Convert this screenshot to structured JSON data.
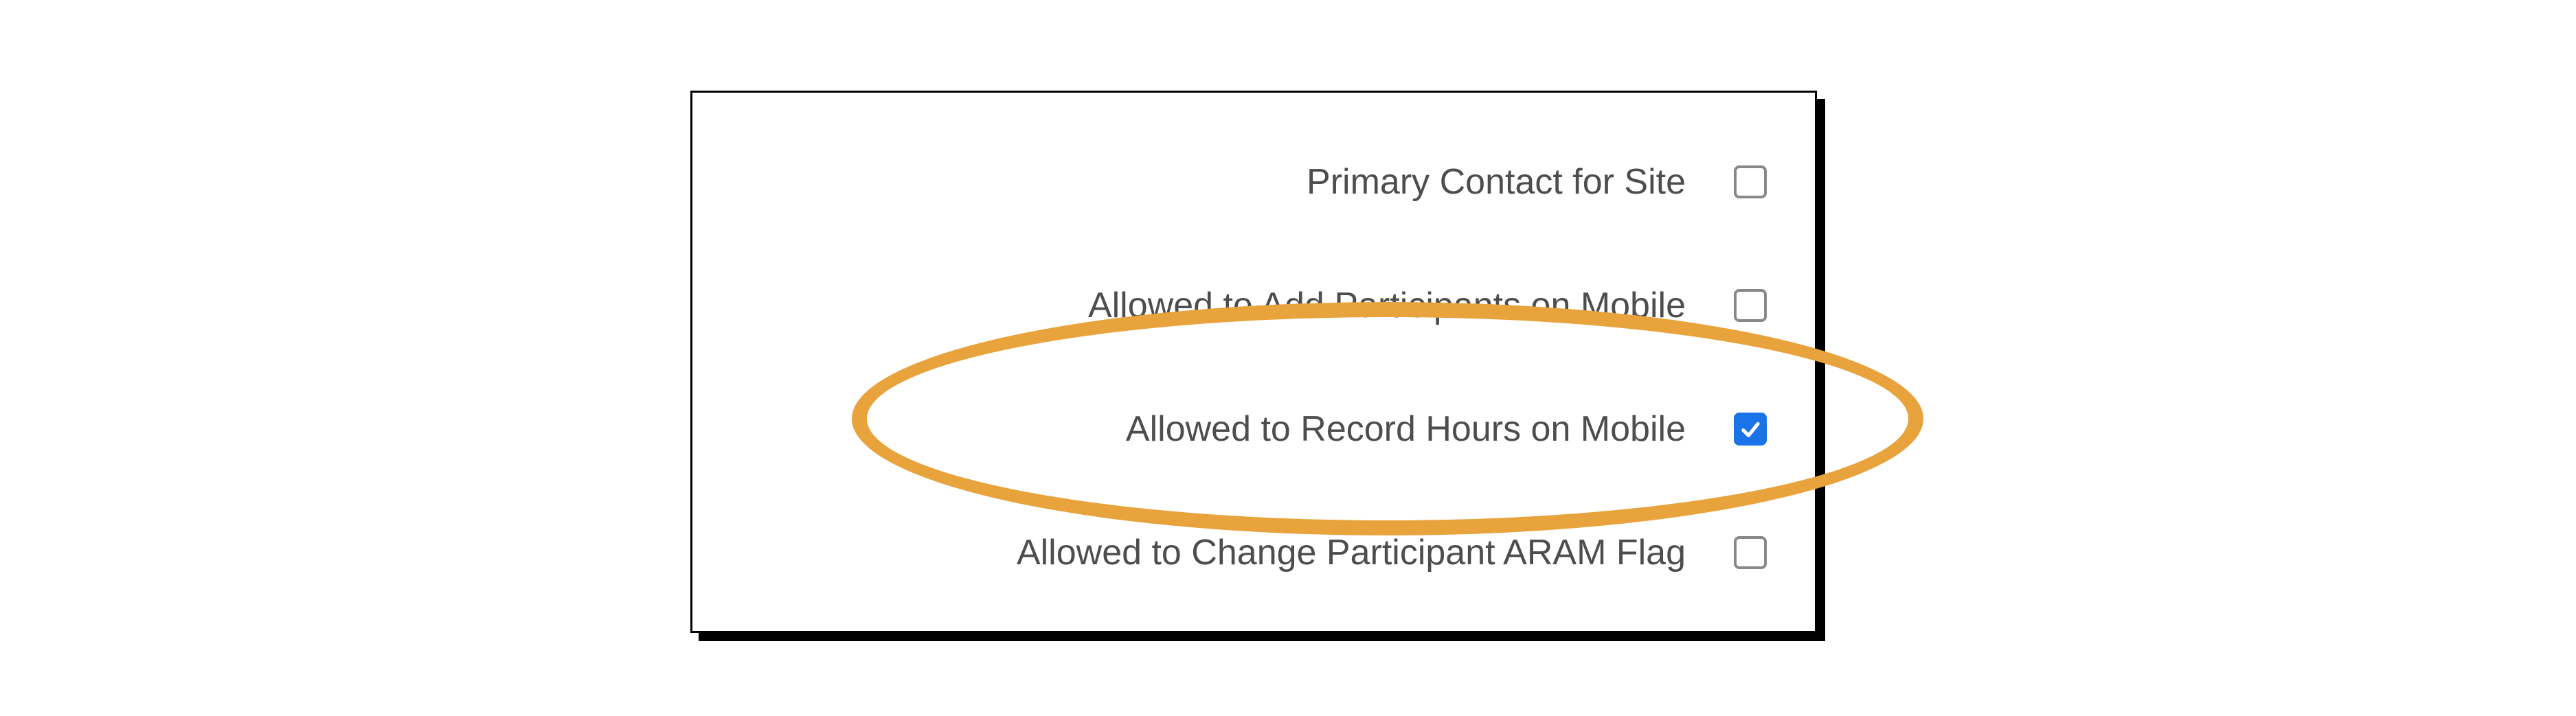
{
  "colors": {
    "highlight": "#e8a33d",
    "checkbox_checked_bg": "#1a73e8",
    "label_text": "#4d4d4d"
  },
  "settings": {
    "rows": [
      {
        "key": "primary-contact",
        "label": "Primary Contact for Site",
        "checked": false
      },
      {
        "key": "add-participants-mobile",
        "label": "Allowed to Add Participants on Mobile",
        "checked": false
      },
      {
        "key": "record-hours-mobile",
        "label": "Allowed to Record Hours on Mobile",
        "checked": true
      },
      {
        "key": "change-aram-flag",
        "label": "Allowed to Change Participant ARAM Flag",
        "checked": false
      }
    ]
  },
  "annotation": {
    "highlighted_row_key": "record-hours-mobile"
  }
}
